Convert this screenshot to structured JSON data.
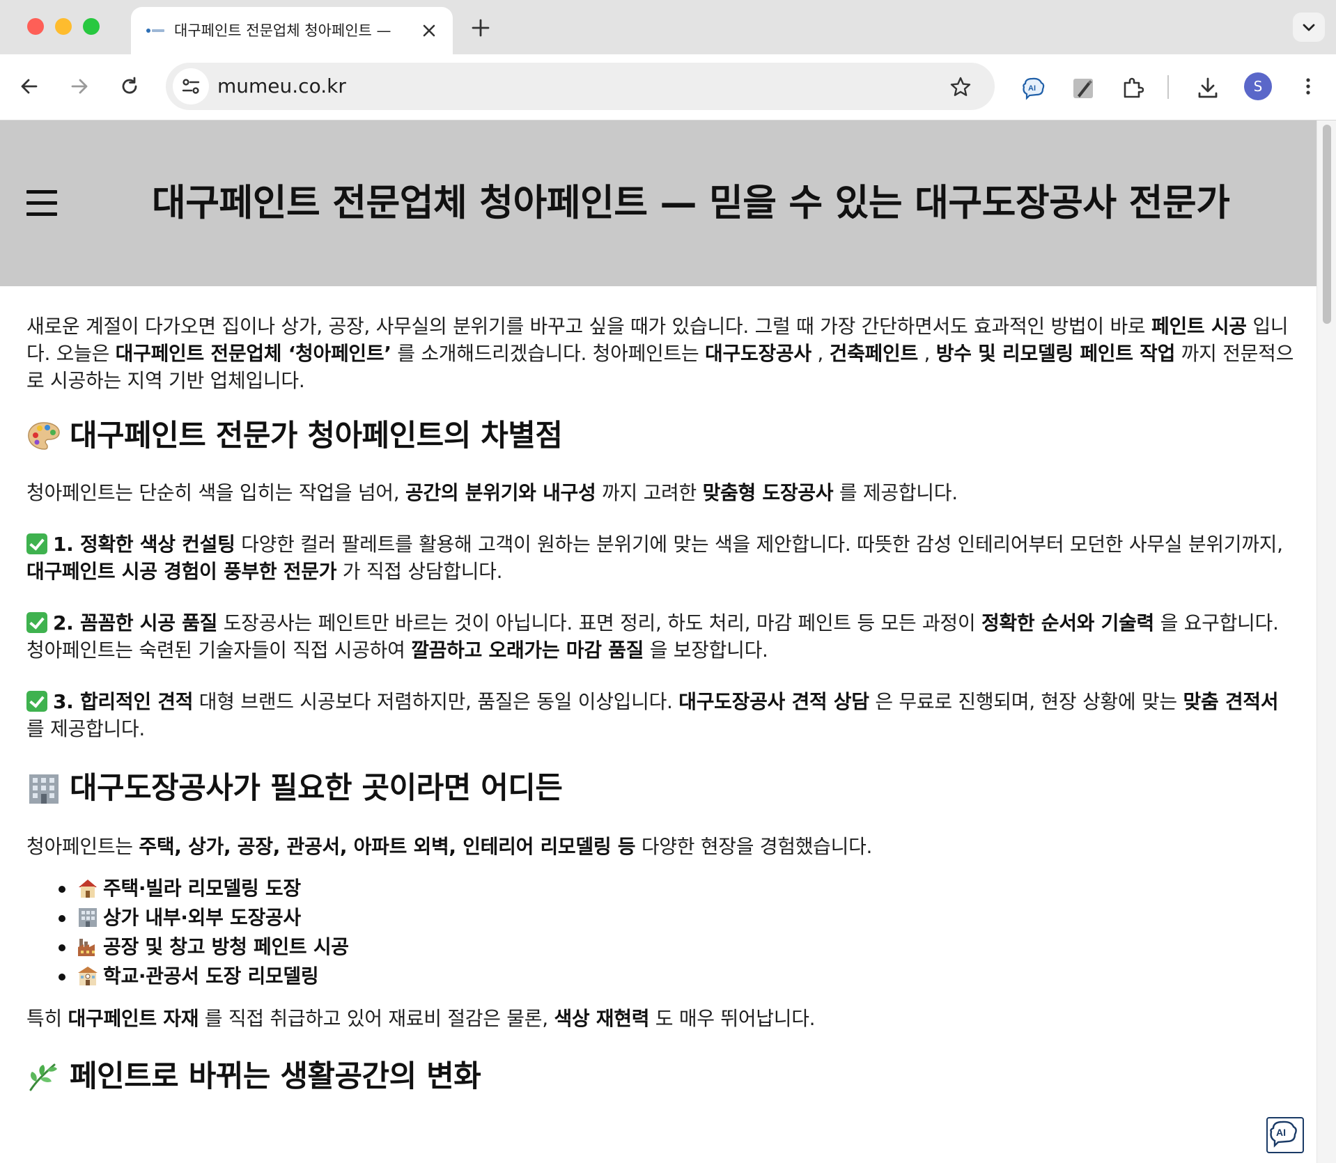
{
  "browser": {
    "tab": {
      "title": "대구페인트 전문업체 청아페인트 —"
    },
    "address": {
      "url": "mumeu.co.kr"
    },
    "profile_initial": "S",
    "colors": {
      "close": "#fe5f57",
      "minimize": "#febc2e",
      "zoom": "#28c840",
      "avatar": "#5a67c9"
    },
    "toolbar_icons": [
      "back-arrow-icon",
      "forward-arrow-icon",
      "reload-icon",
      "site-info-icon",
      "bookmark-star-icon",
      "ai-extension-icon",
      "pen-extension-icon",
      "extensions-puzzle-icon",
      "download-icon",
      "profile-avatar",
      "more-menu-icon"
    ]
  },
  "page": {
    "hero_title": "대구페인트 전문업체 청아페인트 — 믿을 수 있는 대구도장공사 전문가",
    "intro": {
      "t1": "새로운 계절이 다가오면 집이나 상가, 공장, 사무실의 분위기를 바꾸고 싶을 때가 있습니다. 그럴 때 가장 간단하면서도 효과적인 방법이 바로 ",
      "b1": "페인트 시공",
      "t2": " 입니다. 오늘은 ",
      "b2": "대구페인트 전문업체 ‘청아페인트’",
      "t3": " 를 소개해드리겠습니다. 청아페인트는 ",
      "b3": "대구도장공사",
      "t4": " , ",
      "b4": "건축페인트",
      "t5": " , ",
      "b5": "방수 및 리모델링 페인트 작업",
      "t6": " 까지 전문적으로 시공하는 지역 기반 업체입니다."
    },
    "section1": {
      "heading": "대구페인트 전문가 청아페인트의 차별점",
      "lead": {
        "t1": "청아페인트는 단순히 색을 입히는 작업을 넘어, ",
        "b1": "공간의 분위기와 내구성",
        "t2": " 까지 고려한 ",
        "b2": "맞춤형 도장공사",
        "t3": " 를 제공합니다."
      },
      "points": [
        {
          "b1": "1. 정확한 색상 컨설팅",
          "t1": " 다양한 컬러 팔레트를 활용해 고객이 원하는 분위기에 맞는 색을 제안합니다. 따뜻한 감성 인테리어부터 모던한 사무실 분위기까지, ",
          "b2": "대구페인트 시공 경험이 풍부한 전문가",
          "t2": " 가 직접 상담합니다.",
          "b3": "",
          "t3": ""
        },
        {
          "b1": "2. 꼼꼼한 시공 품질",
          "t1": " 도장공사는 페인트만 바르는 것이 아닙니다. 표면 정리, 하도 처리, 마감 페인트 등 모든 과정이 ",
          "b2": "정확한 순서와 기술력",
          "t2": " 을 요구합니다. 청아페인트는 숙련된 기술자들이 직접 시공하여 ",
          "b3": "깔끔하고 오래가는 마감 품질",
          "t3": " 을 보장합니다."
        },
        {
          "b1": "3. 합리적인 견적",
          "t1": " 대형 브랜드 시공보다 저렴하지만, 품질은 동일 이상입니다. ",
          "b2": "대구도장공사 견적 상담",
          "t2": " 은 무료로 진행되며, 현장 상황에 맞는 ",
          "b3": "맞춤 견적서",
          "t3": " 를 제공합니다."
        }
      ]
    },
    "section2": {
      "heading": "대구도장공사가 필요한 곳이라면 어디든",
      "lead": {
        "t1": "청아페인트는 ",
        "b1": "주택, 상가, 공장, 관공서, 아파트 외벽, 인테리어 리모델링 등",
        "t2": " 다양한 현장을 경험했습니다."
      },
      "list": [
        {
          "icon": "house-icon",
          "label": "주택·빌라 리모델링 도장"
        },
        {
          "icon": "office-building-icon",
          "label": "상가 내부·외부 도장공사"
        },
        {
          "icon": "factory-icon",
          "label": "공장 및 창고 방청 페인트 시공"
        },
        {
          "icon": "school-icon",
          "label": "학교·관공서 도장 리모델링"
        }
      ],
      "closing": {
        "t1": "특히 ",
        "b1": "대구페인트 자재",
        "t2": " 를 직접 취급하고 있어 재료비 절감은 물론, ",
        "b2": "색상 재현력",
        "t3": " 도 매우 뛰어납니다."
      }
    },
    "section3": {
      "heading": "페인트로 바뀌는 생활공간의 변화"
    }
  }
}
